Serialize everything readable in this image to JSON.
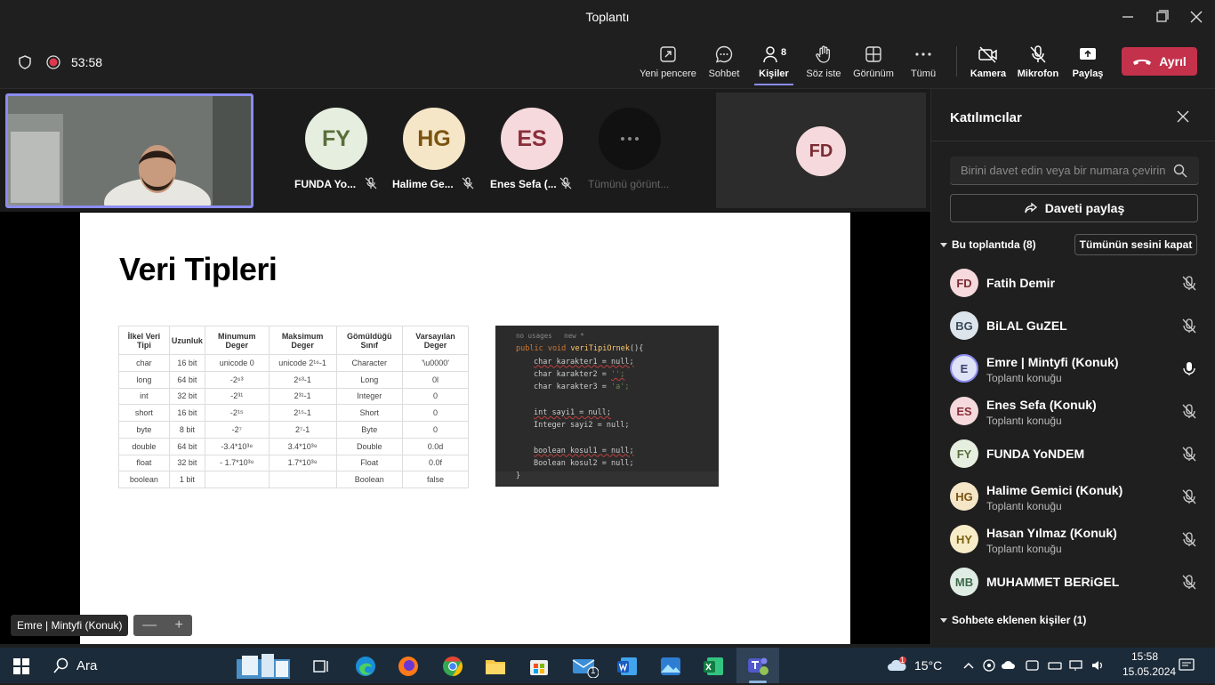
{
  "window": {
    "title": "Toplantı"
  },
  "meeting": {
    "timer": "53:58"
  },
  "toolbar": {
    "new_window": "Yeni pencere",
    "chat": "Sohbet",
    "people": "Kişiler",
    "people_count": "8",
    "raise_hand": "Söz iste",
    "view": "Görünüm",
    "more": "Tümü",
    "camera": "Kamera",
    "mic": "Mikrofon",
    "share": "Paylaş",
    "leave": "Ayrıl"
  },
  "strip": {
    "tiles": [
      {
        "initials": "FY",
        "name": "FUNDA Yo...",
        "bg": "#e6efdf",
        "fg": "#5a6e3b"
      },
      {
        "initials": "HG",
        "name": "Halime Ge...",
        "bg": "#f5e6c8",
        "fg": "#7a5410"
      },
      {
        "initials": "ES",
        "name": "Enes Sefa (...",
        "bg": "#f5d9dc",
        "fg": "#8a2e3b"
      }
    ],
    "more_label": "Tümünü görünt...",
    "spotlight": {
      "initials": "FD",
      "bg": "#f5d9dc",
      "fg": "#7a2b33"
    }
  },
  "slide": {
    "title": "Veri Tipleri",
    "table": {
      "headers": [
        "İlkel Veri Tipi",
        "Uzunluk",
        "Minumum Deger",
        "Maksimum Deger",
        "Gömüldüğü Sınıf",
        "Varsayılan Deger"
      ],
      "rows": [
        [
          "char",
          "16 bit",
          "unicode 0",
          "unicode 2¹⁶-1",
          "Character",
          "'\\u0000'"
        ],
        [
          "long",
          "64 bit",
          "-2⁶³",
          "2⁶³-1",
          "Long",
          "0l"
        ],
        [
          "int",
          "32 bit",
          "-2³¹",
          "2³¹-1",
          "Integer",
          "0"
        ],
        [
          "short",
          "16 bit",
          "-2¹⁵",
          "2¹⁵-1",
          "Short",
          "0"
        ],
        [
          "byte",
          "8 bit",
          "-2⁷",
          "2⁷-1",
          "Byte",
          "0"
        ],
        [
          "double",
          "64 bit",
          "-3.4*10³⁸",
          "3.4*10³⁸",
          "Double",
          "0.0d"
        ],
        [
          "float",
          "32 bit",
          "- 1.7*10³⁸",
          "1.7*10³⁸",
          "Float",
          "0.0f"
        ],
        [
          "boolean",
          "1 bit",
          "",
          "",
          "Boolean",
          "false"
        ]
      ]
    },
    "code": {
      "hint": "no usages   new *",
      "l1_kw": "public void ",
      "l1_fn": "veriTipiOrnek",
      "l1_end": "(){",
      "l2": "char karakter1 = null;",
      "l3_a": "char karakter2 = ",
      "l3_b": "'';",
      "l4_a": "char karakter3 = ",
      "l4_b": "'a';",
      "l5": "int sayi1 = null;",
      "l6": "Integer sayi2 = null;",
      "l7": "boolean kosul1 = null;",
      "l8": "Boolean kosul2 = null;",
      "l9": "}"
    }
  },
  "self_view": {
    "name": "Emre | Mintyfi (Konuk)"
  },
  "zoom": {
    "minus": "—",
    "plus": "+"
  },
  "panel": {
    "title": "Katılımcılar",
    "search_placeholder": "Birini davet edin veya bir numara çevirin",
    "share_invite": "Daveti paylaş",
    "in_meeting": "Bu toplantıda (8)",
    "mute_all": "Tümünün sesini kapat",
    "added_from_chat": "Sohbete eklenen kişiler (1)",
    "participants": [
      {
        "initials": "FD",
        "name": "Fatih Demir",
        "sub": "",
        "bg": "#f5d9dc",
        "fg": "#7a2b33"
      },
      {
        "initials": "BG",
        "name": "BiLAL GuZEL",
        "sub": "",
        "bg": "#dde5ec",
        "fg": "#3a4a5a"
      },
      {
        "initials": "E",
        "name": "Emre | Mintyfi (Konuk)",
        "sub": "Toplantı konuğu",
        "bg": "#dfe3f5",
        "fg": "#3a3f6a"
      },
      {
        "initials": "ES",
        "name": "Enes Sefa (Konuk)",
        "sub": "Toplantı konuğu",
        "bg": "#f5d9dc",
        "fg": "#8a2e3b"
      },
      {
        "initials": "FY",
        "name": "FUNDA YoNDEM",
        "sub": "",
        "bg": "#e6efdf",
        "fg": "#5a6e3b"
      },
      {
        "initials": "HG",
        "name": "Halime Gemici (Konuk)",
        "sub": "Toplantı konuğu",
        "bg": "#f5e6c8",
        "fg": "#7a5410"
      },
      {
        "initials": "HY",
        "name": "Hasan Yılmaz (Konuk)",
        "sub": "Toplantı konuğu",
        "bg": "#f7ecc8",
        "fg": "#7a6010"
      },
      {
        "initials": "MB",
        "name": "MUHAMMET BERiGEL",
        "sub": "",
        "bg": "#dfece3",
        "fg": "#3b6a4a"
      }
    ]
  },
  "taskbar": {
    "search": "Ara",
    "weather": "15°C",
    "weather_badge": "1",
    "mail_badge": "1",
    "time": "15:58",
    "date": "15.05.2024"
  },
  "colors": {
    "accent": "#8b8cf0",
    "leave": "#c4314b",
    "taskbar": "#1c2b3a"
  }
}
